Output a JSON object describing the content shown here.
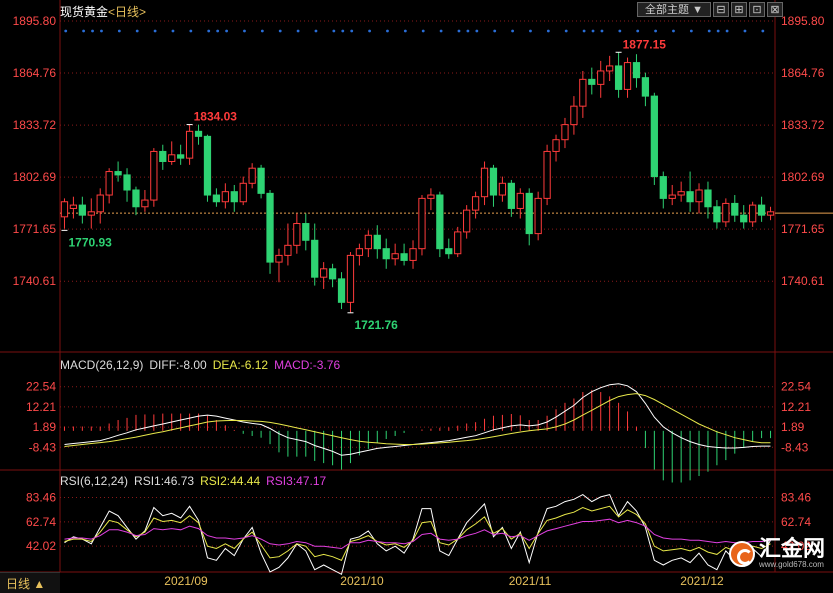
{
  "header": {
    "symbol": "现货黄金",
    "period_label": "<日线>"
  },
  "toolbar": {
    "theme_select": "全部主题",
    "btn_a": "⊟",
    "btn_b": "⊞",
    "btn_c": "⊡",
    "btn_d": "⊠"
  },
  "macd": {
    "label": "MACD(26,12,9)",
    "diff": "DIFF:-8.00",
    "dea": "DEA:-6.12",
    "macd": "MACD:-3.76",
    "ticks": [
      "22.54",
      "12.21",
      "1.89",
      "-8.43"
    ]
  },
  "rsi": {
    "label": "RSI(6,12,24)",
    "rsi1": "RSI1:46.73",
    "rsi2": "RSI2:44.44",
    "rsi3": "RSI3:47.17",
    "ticks": [
      "83.46",
      "62.74",
      "42.02"
    ]
  },
  "footer": {
    "period": "日线 ▲"
  },
  "logo": {
    "name": "汇金网",
    "url": "www.gold678.com"
  },
  "colors": {
    "up": "#ff3b3b",
    "down": "#2ed373",
    "diff": "#ffffff",
    "dea": "#e8e84a",
    "macd_label": "#e040e0",
    "grid": "#8b1a1a",
    "axis_text": "#ff4a4a",
    "last_price": "#e8a050",
    "dots": "#2a6ed8"
  },
  "chart_data": {
    "type": "candlestick",
    "price_ticks": [
      "1895.80",
      "1864.76",
      "1833.72",
      "1802.69",
      "1771.65",
      "1740.61"
    ],
    "price_range": [
      1711.5,
      1895.8
    ],
    "last_price": 1781.2,
    "x_labels": [
      "2021/09",
      "2021/10",
      "2021/11",
      "2021/12"
    ],
    "annotations": [
      {
        "text": "1834.03",
        "value": 1834.03,
        "kind": "high"
      },
      {
        "text": "1770.93",
        "value": 1770.93,
        "kind": "low"
      },
      {
        "text": "1721.76",
        "value": 1721.76,
        "kind": "low"
      },
      {
        "text": "1877.15",
        "value": 1877.15,
        "kind": "high"
      }
    ],
    "candles": [
      [
        1779,
        1788,
        1772,
        1790
      ],
      [
        1784,
        1786,
        1778,
        1791
      ],
      [
        1786,
        1780,
        1775,
        1791
      ],
      [
        1780,
        1782,
        1772,
        1790
      ],
      [
        1782,
        1792,
        1775,
        1796
      ],
      [
        1792,
        1806,
        1787,
        1808
      ],
      [
        1806,
        1804,
        1800,
        1812
      ],
      [
        1804,
        1795,
        1788,
        1808
      ],
      [
        1795,
        1785,
        1780,
        1797
      ],
      [
        1785,
        1789,
        1782,
        1795
      ],
      [
        1789,
        1818,
        1785,
        1820
      ],
      [
        1818,
        1812,
        1807,
        1822
      ],
      [
        1812,
        1816,
        1810,
        1824
      ],
      [
        1816,
        1814,
        1810,
        1822
      ],
      [
        1814,
        1830,
        1810,
        1834
      ],
      [
        1830,
        1827,
        1822,
        1834
      ],
      [
        1827,
        1792,
        1788,
        1828
      ],
      [
        1792,
        1788,
        1785,
        1796
      ],
      [
        1788,
        1794,
        1784,
        1799
      ],
      [
        1794,
        1788,
        1782,
        1798
      ],
      [
        1788,
        1799,
        1786,
        1803
      ],
      [
        1799,
        1808,
        1796,
        1811
      ],
      [
        1808,
        1793,
        1790,
        1810
      ],
      [
        1793,
        1752,
        1745,
        1795
      ],
      [
        1752,
        1756,
        1740,
        1760
      ],
      [
        1756,
        1762,
        1750,
        1775
      ],
      [
        1762,
        1775,
        1757,
        1781
      ],
      [
        1775,
        1765,
        1759,
        1781
      ],
      [
        1765,
        1743,
        1738,
        1775
      ],
      [
        1743,
        1748,
        1736,
        1752
      ],
      [
        1748,
        1742,
        1737,
        1751
      ],
      [
        1742,
        1728,
        1724,
        1746
      ],
      [
        1728,
        1756,
        1722,
        1758
      ],
      [
        1756,
        1760,
        1750,
        1763
      ],
      [
        1760,
        1768,
        1755,
        1771
      ],
      [
        1768,
        1760,
        1754,
        1774
      ],
      [
        1760,
        1754,
        1748,
        1766
      ],
      [
        1754,
        1757,
        1750,
        1763
      ],
      [
        1757,
        1753,
        1750,
        1763
      ],
      [
        1753,
        1760,
        1748,
        1765
      ],
      [
        1760,
        1790,
        1756,
        1792
      ],
      [
        1790,
        1792,
        1783,
        1796
      ],
      [
        1792,
        1760,
        1755,
        1794
      ],
      [
        1760,
        1757,
        1754,
        1766
      ],
      [
        1757,
        1770,
        1755,
        1773
      ],
      [
        1770,
        1783,
        1766,
        1786
      ],
      [
        1783,
        1791,
        1778,
        1794
      ],
      [
        1791,
        1808,
        1786,
        1812
      ],
      [
        1808,
        1792,
        1785,
        1810
      ],
      [
        1792,
        1799,
        1788,
        1803
      ],
      [
        1799,
        1784,
        1779,
        1801
      ],
      [
        1784,
        1793,
        1778,
        1796
      ],
      [
        1793,
        1769,
        1762,
        1796
      ],
      [
        1769,
        1790,
        1765,
        1794
      ],
      [
        1790,
        1818,
        1786,
        1822
      ],
      [
        1818,
        1825,
        1812,
        1828
      ],
      [
        1825,
        1834,
        1820,
        1838
      ],
      [
        1834,
        1845,
        1828,
        1851
      ],
      [
        1845,
        1861,
        1838,
        1866
      ],
      [
        1861,
        1858,
        1852,
        1868
      ],
      [
        1858,
        1866,
        1850,
        1872
      ],
      [
        1866,
        1869,
        1860,
        1875
      ],
      [
        1869,
        1855,
        1850,
        1877
      ],
      [
        1855,
        1871,
        1850,
        1874
      ],
      [
        1871,
        1862,
        1856,
        1876
      ],
      [
        1862,
        1851,
        1845,
        1865
      ],
      [
        1851,
        1803,
        1798,
        1853
      ],
      [
        1803,
        1790,
        1784,
        1806
      ],
      [
        1790,
        1792,
        1786,
        1798
      ],
      [
        1792,
        1794,
        1788,
        1800
      ],
      [
        1794,
        1788,
        1782,
        1806
      ],
      [
        1788,
        1795,
        1781,
        1799
      ],
      [
        1795,
        1785,
        1778,
        1800
      ],
      [
        1785,
        1776,
        1772,
        1789
      ],
      [
        1776,
        1787,
        1773,
        1790
      ],
      [
        1787,
        1780,
        1776,
        1792
      ],
      [
        1780,
        1776,
        1772,
        1786
      ],
      [
        1776,
        1786,
        1773,
        1788
      ],
      [
        1786,
        1780,
        1776,
        1791
      ],
      [
        1780,
        1782,
        1777,
        1785
      ]
    ],
    "macd": {
      "ylim": [
        -19,
        28
      ],
      "series": [
        {
          "name": "DIFF",
          "values": [
            -7,
            -6.5,
            -6,
            -5.5,
            -5,
            -3.8,
            -2.3,
            -1,
            0.5,
            1.5,
            2.5,
            3.5,
            4.5,
            5.5,
            6.5,
            7.5,
            8.0,
            7.5,
            6.5,
            5.5,
            4.5,
            3.8,
            3.2,
            1.2,
            -1.5,
            -3.5,
            -4.5,
            -5.5,
            -7.5,
            -9,
            -10.5,
            -12.5,
            -12,
            -11,
            -10,
            -9,
            -8.5,
            -8,
            -7.5,
            -7,
            -6.5,
            -6,
            -5.5,
            -5,
            -4.2,
            -3.3,
            -2.5,
            -1,
            0.5,
            1.5,
            2.5,
            3,
            2.5,
            3,
            4.5,
            7,
            10,
            13,
            17,
            20,
            22,
            23.5,
            24,
            23,
            20,
            14,
            7,
            2,
            -1,
            -3.5,
            -5.5,
            -7,
            -8,
            -8.5,
            -8.8,
            -8.8,
            -8.5,
            -8,
            -7.8,
            -7.8
          ]
        },
        {
          "name": "DEA",
          "values": [
            -8,
            -7.5,
            -7,
            -6.5,
            -6,
            -5.5,
            -4.8,
            -4,
            -3.2,
            -2.3,
            -1.3,
            -0.5,
            0.5,
            1.5,
            2.5,
            3.5,
            4.5,
            5,
            5.2,
            5.3,
            5.2,
            5.0,
            4.8,
            4.3,
            3.5,
            2.5,
            1.5,
            0.5,
            -0.5,
            -1.5,
            -2.5,
            -3.5,
            -4.5,
            -5.3,
            -5.8,
            -6.2,
            -6.6,
            -6.8,
            -7,
            -7,
            -6.8,
            -6.5,
            -6.2,
            -5.8,
            -5.4,
            -5,
            -4.5,
            -3.8,
            -3,
            -2.2,
            -1.4,
            -0.6,
            0,
            0.5,
            1,
            2,
            3.5,
            5.5,
            8,
            10.5,
            13,
            15.5,
            17.5,
            18.5,
            19,
            18,
            16,
            13.5,
            11,
            8.5,
            6,
            3.5,
            1.5,
            -0.5,
            -2,
            -3.5,
            -4.5,
            -5.5,
            -6.1,
            -6.1
          ]
        }
      ]
    },
    "rsi": {
      "ylim": [
        20,
        95
      ],
      "series": [
        {
          "name": "RSI1",
          "values": [
            45,
            50,
            48,
            44,
            58,
            72,
            68,
            58,
            48,
            55,
            75,
            68,
            70,
            66,
            76,
            64,
            32,
            30,
            40,
            34,
            48,
            58,
            36,
            20,
            24,
            32,
            44,
            38,
            22,
            26,
            22,
            18,
            48,
            50,
            55,
            44,
            38,
            42,
            36,
            48,
            74,
            74,
            38,
            34,
            48,
            62,
            70,
            78,
            50,
            58,
            40,
            54,
            28,
            54,
            74,
            76,
            80,
            82,
            86,
            80,
            84,
            86,
            68,
            80,
            72,
            58,
            30,
            26,
            30,
            32,
            28,
            36,
            26,
            22,
            38,
            30,
            28,
            40,
            33,
            47
          ]
        },
        {
          "name": "RSI2",
          "values": [
            46,
            48,
            48,
            46,
            54,
            64,
            62,
            56,
            50,
            54,
            66,
            63,
            64,
            62,
            68,
            62,
            42,
            40,
            44,
            40,
            48,
            54,
            43,
            32,
            33,
            38,
            44,
            42,
            33,
            35,
            33,
            30,
            46,
            48,
            51,
            46,
            43,
            44,
            41,
            47,
            62,
            63,
            45,
            43,
            48,
            56,
            61,
            67,
            53,
            57,
            48,
            53,
            40,
            53,
            64,
            66,
            69,
            71,
            75,
            72,
            74,
            76,
            67,
            73,
            69,
            61,
            42,
            38,
            39,
            40,
            38,
            41,
            37,
            35,
            41,
            38,
            37,
            42,
            40,
            44
          ]
        },
        {
          "name": "RSI3",
          "values": [
            48,
            49,
            49,
            48,
            51,
            56,
            56,
            54,
            51,
            52,
            57,
            56,
            57,
            56,
            59,
            57,
            51,
            49,
            49,
            48,
            49,
            51,
            48,
            44,
            43,
            44,
            46,
            45,
            42,
            42,
            41,
            40,
            45,
            45,
            47,
            46,
            45,
            45,
            44,
            46,
            52,
            53,
            48,
            47,
            48,
            51,
            53,
            56,
            52,
            53,
            50,
            51,
            47,
            51,
            55,
            57,
            59,
            61,
            63,
            63,
            64,
            65,
            62,
            64,
            62,
            59,
            52,
            49,
            48,
            48,
            47,
            47,
            46,
            45,
            46,
            45,
            45,
            46,
            46,
            47
          ]
        }
      ]
    }
  }
}
